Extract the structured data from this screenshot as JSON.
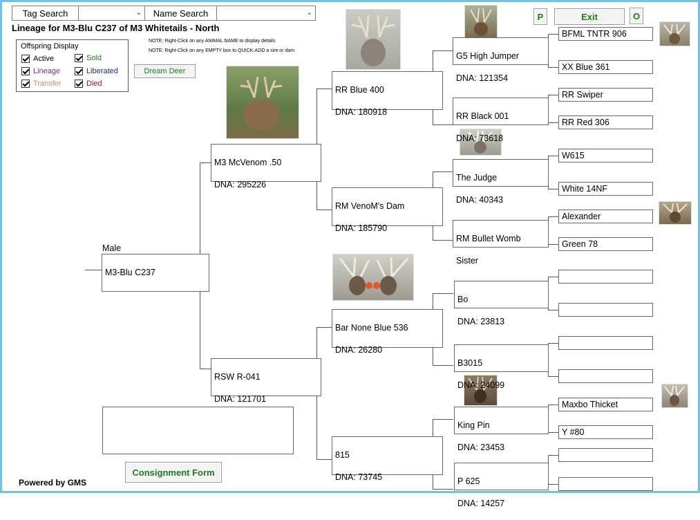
{
  "search": {
    "tag_label": "Tag Search",
    "name_label": "Name Search"
  },
  "header": {
    "title": "Lineage for M3-Blu C237 of M3 Whitetails - North",
    "note1": "NOTE: Right-Click on any ANIMAL NAME to display details",
    "note2": "NOTE: Right-Click on any EMPTY box to QUICK-ADD a sire or dam"
  },
  "legend": {
    "title": "Offspring Display",
    "items": [
      {
        "label": "Active",
        "color": "#000000"
      },
      {
        "label": "Sold",
        "color": "#1a7d1a"
      },
      {
        "label": "Lineage",
        "color": "#7b2d8b"
      },
      {
        "label": "Liberated",
        "color": "#1c2a8a"
      },
      {
        "label": "Transfer",
        "color": "#e8826a"
      },
      {
        "label": "Died",
        "color": "#8b1a1a"
      }
    ]
  },
  "buttons": {
    "dream_deer": "Dream Deer",
    "p": "P",
    "exit": "Exit",
    "o": "O",
    "consignment": "Consignment Form"
  },
  "subject": {
    "sex": "Male",
    "name": "M3-Blu C237"
  },
  "gen1": {
    "sire": {
      "name": "M3 McVenom .50",
      "dna": "DNA:  295226"
    },
    "dam": {
      "name": "RSW R-041",
      "dna": "DNA:  121701"
    }
  },
  "gen2": [
    {
      "name": "RR Blue 400",
      "dna": "DNA:  180918"
    },
    {
      "name": "RM VenoM's Dam",
      "dna": "DNA:  185790"
    },
    {
      "name": "Bar None Blue 536",
      "dna": "DNA:  26280"
    },
    {
      "name": "815",
      "dna": "DNA:  73745"
    }
  ],
  "gen3": [
    {
      "name": "G5 High Jumper",
      "dna": "DNA:  121354"
    },
    {
      "name": "RR Black 001",
      "dna": "DNA:  73618"
    },
    {
      "name": "The Judge",
      "dna": "DNA:  40343"
    },
    {
      "name": "RM Bullet Womb",
      "dna": "Sister"
    },
    {
      "name": "Bo",
      "dna": "DNA:  23813"
    },
    {
      "name": "B3015",
      "dna": "DNA:  24099"
    },
    {
      "name": "King Pin",
      "dna": "DNA:  23453"
    },
    {
      "name": "P 625",
      "dna": "DNA:  14257"
    }
  ],
  "gen4": [
    "BFML TNTR 906",
    "XX Blue 361",
    "RR Swiper",
    "RR Red 306",
    "W615",
    "White 14NF",
    "Alexander",
    "Green 78",
    "",
    "",
    "",
    "",
    "Maxbo Thicket",
    "Y #80",
    "",
    ""
  ],
  "footer": {
    "powered_by": "Powered by GMS"
  }
}
